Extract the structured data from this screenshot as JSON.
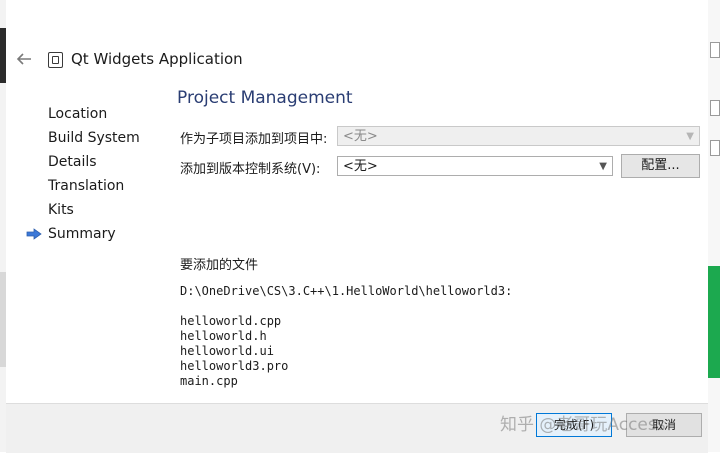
{
  "header": {
    "app_title": "Qt Widgets Application"
  },
  "sidebar": {
    "items": [
      {
        "label": "Location"
      },
      {
        "label": "Build System"
      },
      {
        "label": "Details"
      },
      {
        "label": "Translation"
      },
      {
        "label": "Kits"
      },
      {
        "label": "Summary",
        "current": true
      }
    ]
  },
  "main": {
    "title": "Project Management",
    "subproject_label": "作为子项目添加到项目中:",
    "subproject_value": "<无>",
    "vcs_label": "添加到版本控制系统(V):",
    "vcs_value": "<无>",
    "configure_label": "配置...",
    "files_label": "要添加的文件",
    "files_path": "D:\\OneDrive\\CS\\3.C++\\1.HelloWorld\\helloworld3:",
    "files": [
      "helloworld.cpp",
      "helloworld.h",
      "helloworld.ui",
      "helloworld3.pro",
      "main.cpp"
    ]
  },
  "footer": {
    "finish_label": "完成(F)",
    "cancel_label": "取消"
  },
  "watermark": "知乎 @老哥玩Access",
  "colors": {
    "accent_blue": "#2a3d73",
    "arrow_blue": "#3b78d8",
    "footer_bg": "#f0f0f0"
  }
}
